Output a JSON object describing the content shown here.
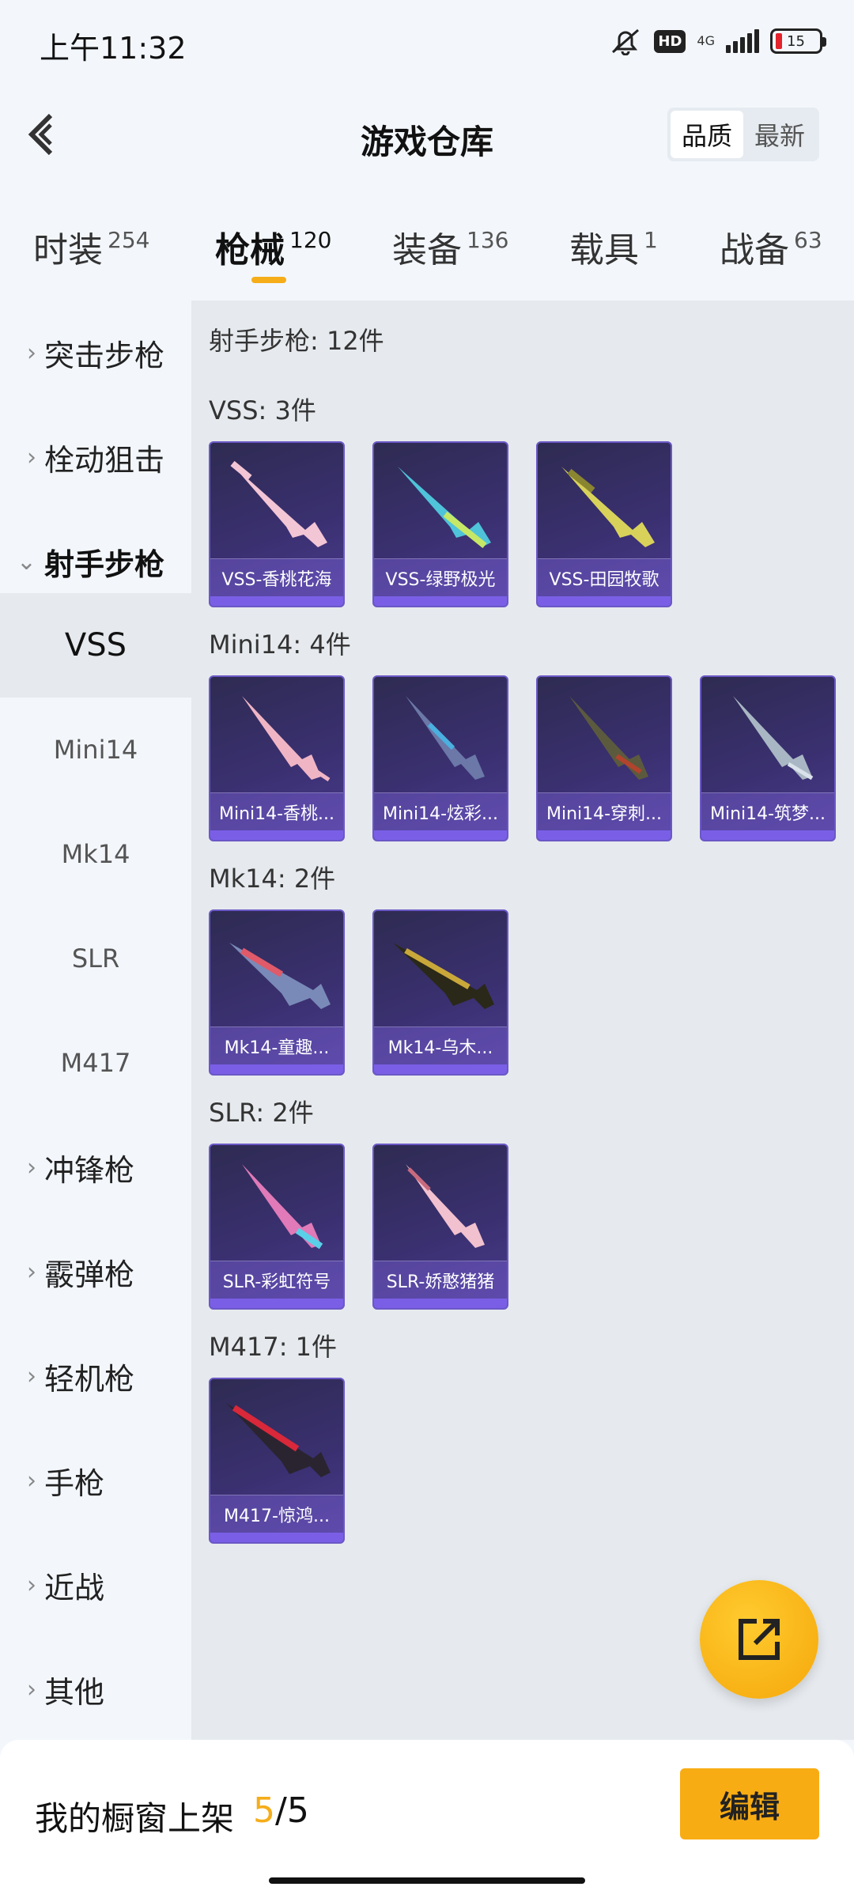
{
  "status": {
    "time": "上午11:32",
    "hd": "HD",
    "network": "4G",
    "battery": "15"
  },
  "header": {
    "title": "游戏仓库",
    "sort": [
      "品质",
      "最新"
    ]
  },
  "tabs": [
    {
      "label": "时装",
      "count": "254"
    },
    {
      "label": "枪械",
      "count": "120"
    },
    {
      "label": "装备",
      "count": "136"
    },
    {
      "label": "载具",
      "count": "1"
    },
    {
      "label": "战备",
      "count": "63"
    }
  ],
  "sidebar": {
    "categories": [
      "突击步枪",
      "栓动狙击",
      "射手步枪",
      "冲锋枪",
      "霰弹枪",
      "轻机枪",
      "手枪",
      "近战",
      "其他"
    ],
    "subs": [
      "VSS",
      "Mini14",
      "Mk14",
      "SLR",
      "M417"
    ]
  },
  "content": {
    "header": "射手步枪: 12件",
    "sections": [
      {
        "title": "VSS: 3件",
        "items": [
          "VSS-香桃花海",
          "VSS-绿野极光",
          "VSS-田园牧歌"
        ]
      },
      {
        "title": "Mini14: 4件",
        "items": [
          "Mini14-香桃...",
          "Mini14-炫彩...",
          "Mini14-穿刺...",
          "Mini14-筑梦..."
        ]
      },
      {
        "title": "Mk14: 2件",
        "items": [
          "Mk14-童趣...",
          "Mk14-乌木..."
        ]
      },
      {
        "title": "SLR: 2件",
        "items": [
          "SLR-彩虹符号",
          "SLR-娇憨猪猪"
        ]
      },
      {
        "title": "M417: 1件",
        "items": [
          "M417-惊鸿..."
        ]
      }
    ]
  },
  "bottom": {
    "label": "我的橱窗上架",
    "current": "5",
    "separator": "/",
    "total": "5",
    "edit": "编辑"
  },
  "colors": {
    "accent": "#f5ad1a",
    "card_bg": "#3a3070",
    "card_border": "#6b58c6"
  }
}
